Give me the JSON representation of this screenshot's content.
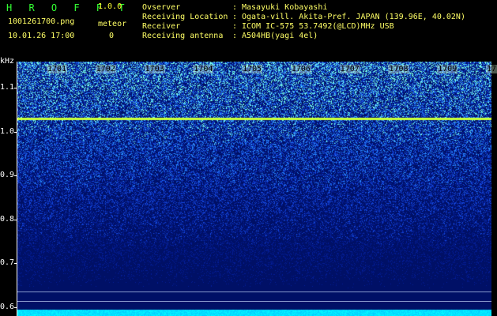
{
  "header": {
    "app_title": "H R O F F T",
    "version": "1.0.0",
    "filename": "1001261700.png",
    "datetime": "10.01.26 17:00",
    "meteor_label": "meteor",
    "meteor_count": "0"
  },
  "info": [
    {
      "key": "Ovserver",
      "value": "Masayuki Kobayashi"
    },
    {
      "key": "Receiving Location",
      "value": "Ogata-vill. Akita-Pref. JAPAN (139.96E, 40.02N)"
    },
    {
      "key": "Receiver",
      "value": "ICOM IC-575 53.7492(@LCD)MHz USB"
    },
    {
      "key": "Receiving antenna",
      "value": "A504HB(yagi 4el)"
    }
  ],
  "chart_data": {
    "type": "heatmap",
    "ylabel": "kHz",
    "y_ticks": [
      "1.1",
      "1.0",
      "0.9",
      "0.8",
      "0.7",
      "0.6"
    ],
    "y_range": [
      0.58,
      1.16
    ],
    "x_ticks": [
      "1701",
      "1702",
      "1703",
      "1704",
      "1705",
      "1706",
      "1707",
      "1708",
      "1709",
      "1710"
    ],
    "carrier_line_khz": 1.03,
    "colors": {
      "low": "#001066",
      "mid": "#2255ff",
      "high": "#33ffcc",
      "peak": "#ffff33"
    }
  }
}
